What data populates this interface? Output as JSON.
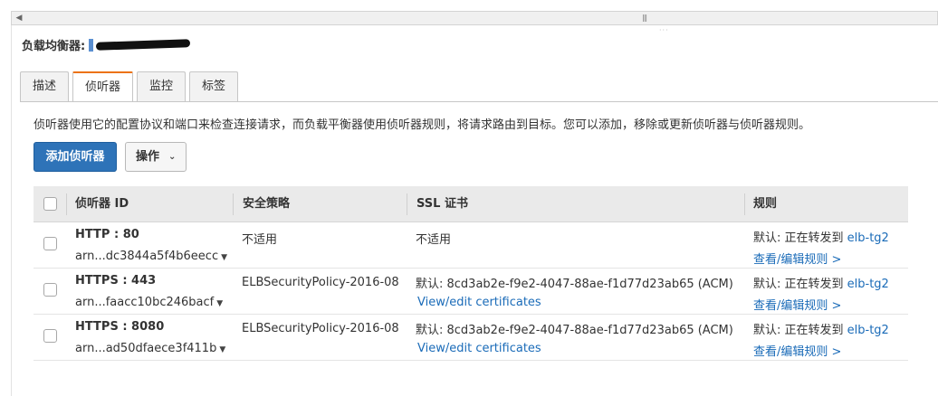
{
  "load_balancer": {
    "label": "负载均衡器:"
  },
  "tabs": [
    {
      "label": "描述",
      "active": false
    },
    {
      "label": "侦听器",
      "active": true
    },
    {
      "label": "监控",
      "active": false
    },
    {
      "label": "标签",
      "active": false
    }
  ],
  "description": "侦听器使用它的配置协议和端口来检查连接请求，而负载平衡器使用侦听器规则，将请求路由到目标。您可以添加，移除或更新侦听器与侦听器规则。",
  "toolbar": {
    "add_listener": "添加侦听器",
    "actions": "操作"
  },
  "table": {
    "columns": [
      "侦听器 ID",
      "安全策略",
      "SSL 证书",
      "规则"
    ],
    "rows": [
      {
        "protocol_port": "HTTP : 80",
        "arn": "arn...dc3844a5f4b6eecc",
        "policy": "不适用",
        "cert": "不适用",
        "cert_link": "",
        "rule_text": "默认:  正在转发到",
        "rule_target": "elb-tg2",
        "rule_link": "查看/编辑规则 >"
      },
      {
        "protocol_port": "HTTPS : 443",
        "arn": "arn...faacc10bc246bacf",
        "policy": "ELBSecurityPolicy-2016-08",
        "cert": "默认:  8cd3ab2e-f9e2-4047-88ae-f1d77d23ab65 (ACM)",
        "cert_link": "View/edit certificates",
        "rule_text": "默认:  正在转发到",
        "rule_target": "elb-tg2",
        "rule_link": "查看/编辑规则 >"
      },
      {
        "protocol_port": "HTTPS : 8080",
        "arn": "arn...ad50dfaece3f411b",
        "policy": "ELBSecurityPolicy-2016-08",
        "cert": "默认:  8cd3ab2e-f9e2-4047-88ae-f1d77d23ab65 (ACM)",
        "cert_link": "View/edit certificates",
        "rule_text": "默认:  正在转发到",
        "rule_target": "elb-tg2",
        "rule_link": "查看/编辑规则 >"
      }
    ]
  },
  "icons": {
    "scroll_left": "triangle-left-icon",
    "grip": "grip-icon",
    "dropdown": "chevron-down-icon",
    "caret": "caret-down-icon"
  },
  "colors": {
    "primary_button": "#2e73b8",
    "active_tab_accent": "#ec7211",
    "link": "#1a6bb8",
    "header_bg": "#eaeaea"
  }
}
